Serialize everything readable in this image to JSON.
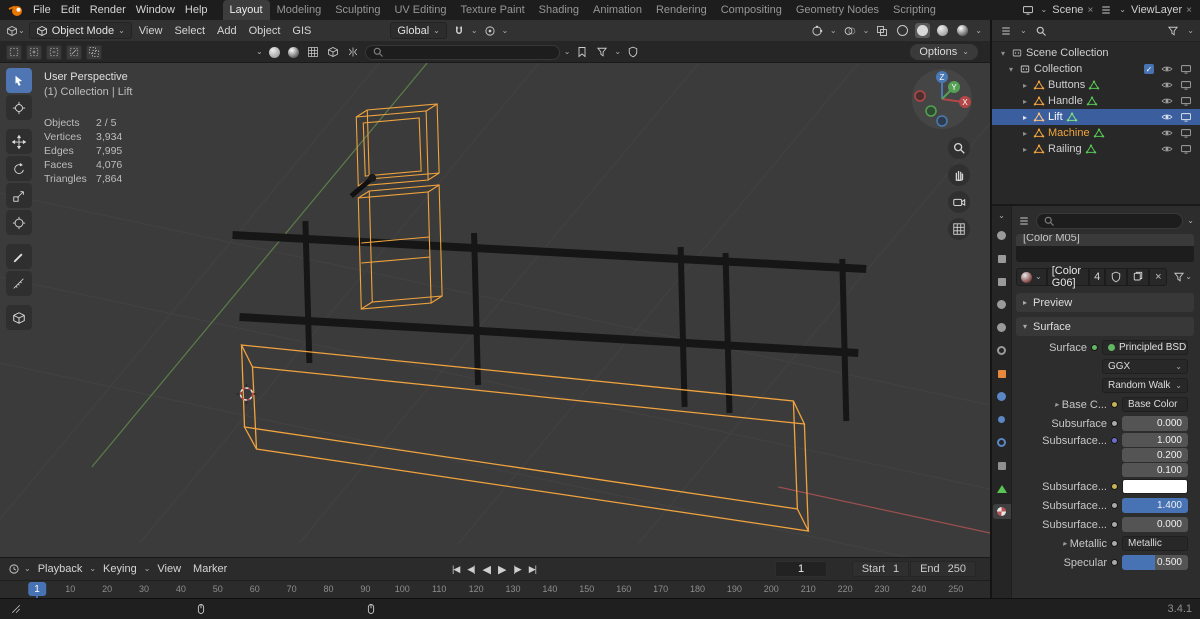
{
  "topbar": {
    "menus": [
      "File",
      "Edit",
      "Render",
      "Window",
      "Help"
    ],
    "workspaces": [
      "Layout",
      "Modeling",
      "Sculpting",
      "UV Editing",
      "Texture Paint",
      "Shading",
      "Animation",
      "Rendering",
      "Compositing",
      "Geometry Nodes",
      "Scripting"
    ],
    "active_workspace": "Layout",
    "scene_label": "Scene",
    "viewlayer_label": "ViewLayer"
  },
  "viewport_header": {
    "mode": "Object Mode",
    "menus": [
      "View",
      "Select",
      "Add",
      "Object",
      "GIS"
    ],
    "orientation": "Global",
    "options_label": "Options"
  },
  "viewport": {
    "perspective_label": "User Perspective",
    "context_label": "(1) Collection | Lift",
    "stats": {
      "rows": [
        {
          "label": "Objects",
          "value": "2 / 5"
        },
        {
          "label": "Vertices",
          "value": "3,934"
        },
        {
          "label": "Edges",
          "value": "7,995"
        },
        {
          "label": "Faces",
          "value": "4,076"
        },
        {
          "label": "Triangles",
          "value": "7,864"
        }
      ]
    },
    "gizmo_axes": {
      "x": "X",
      "y": "Y",
      "z": "Z"
    }
  },
  "outliner": {
    "scene_collection": "Scene Collection",
    "collection": "Collection",
    "objects": [
      {
        "name": "Buttons",
        "selected": false,
        "active": false
      },
      {
        "name": "Handle",
        "selected": false,
        "active": false
      },
      {
        "name": "Lift",
        "selected": true,
        "active": false
      },
      {
        "name": "Machine",
        "selected": false,
        "active": true
      },
      {
        "name": "Railing",
        "selected": false,
        "active": false
      }
    ]
  },
  "properties": {
    "slot_item": "[Color M05]",
    "material_name": "[Color G06]",
    "material_users": "4",
    "preview_section": "Preview",
    "surface_section": "Surface",
    "rows": [
      {
        "label": "Surface",
        "value": "Principled BSDF",
        "socket": "#63b763"
      },
      {
        "label": "",
        "value": "GGX"
      },
      {
        "label": "",
        "value": "Random Walk"
      },
      {
        "label": "Base C...",
        "value": "Base Color",
        "socket": "#c8b255"
      },
      {
        "label": "Subsurface",
        "value": "0.000",
        "socket": "#a8a8a8"
      },
      {
        "label": "Subsurface...",
        "values": [
          "1.000",
          "0.200",
          "0.100"
        ],
        "socket": "#6b6bd0"
      },
      {
        "label": "Subsurface...",
        "color": "#FFFFFF",
        "socket": "#c8b255"
      },
      {
        "label": "Subsurface...",
        "value": "1.400",
        "fill": 1,
        "socket": "#a8a8a8"
      },
      {
        "label": "Subsurface...",
        "value": "0.000",
        "socket": "#a8a8a8"
      },
      {
        "label": "Metallic",
        "value": "Metallic",
        "socket": "#a8a8a8"
      },
      {
        "label": "Specular",
        "value": "0.500",
        "fill": 0.5,
        "socket": "#a8a8a8"
      }
    ]
  },
  "timeline": {
    "menus": [
      "Playback",
      "Keying",
      "View",
      "Marker"
    ],
    "current_frame": "1",
    "start_label": "Start",
    "start_value": "1",
    "end_label": "End",
    "end_value": "250",
    "ticks": [
      "1",
      "10",
      "20",
      "30",
      "40",
      "50",
      "60",
      "70",
      "80",
      "90",
      "100",
      "110",
      "120",
      "130",
      "140",
      "150",
      "160",
      "170",
      "180",
      "190",
      "200",
      "210",
      "220",
      "230",
      "240",
      "250"
    ]
  },
  "statusbar": {
    "version": "3.4.1"
  },
  "colors": {
    "accent": "#4772B3",
    "object_orange": "#F2A13C",
    "mesh_green": "#58C554",
    "wire_orange": "#F0A33E"
  }
}
